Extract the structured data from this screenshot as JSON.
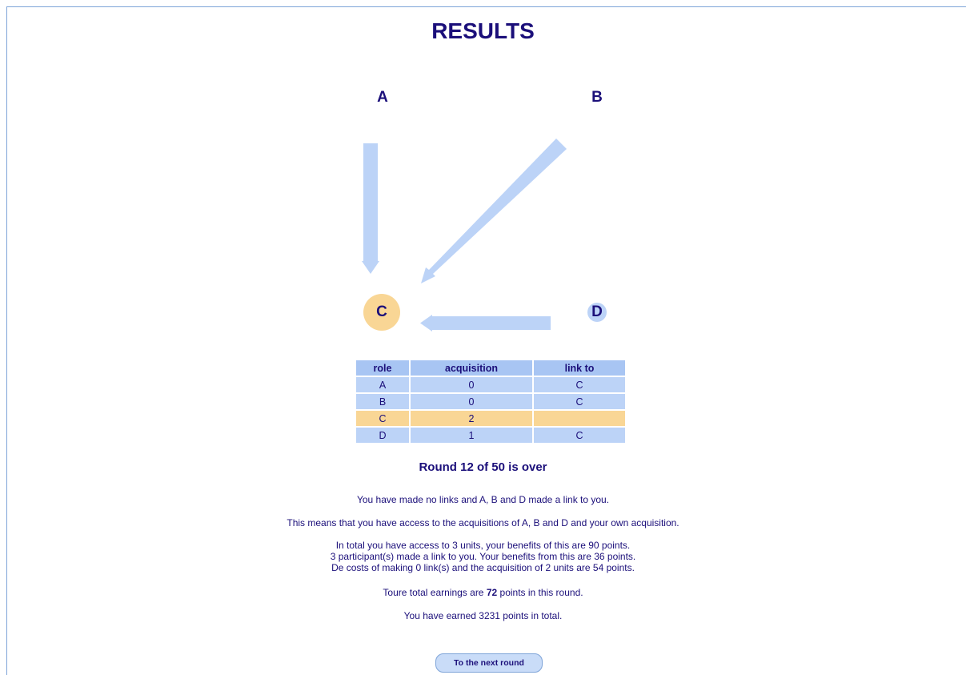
{
  "title": "RESULTS",
  "nodes": {
    "a": "A",
    "b": "B",
    "c": "C",
    "d": "D"
  },
  "colors": {
    "text": "#1b0f7a",
    "arrow": "#bcd3f7",
    "self_node": "#f9d695",
    "header": "#a8c5f3",
    "row": "#bcd3f7"
  },
  "table": {
    "headers": [
      "role",
      "acquisition",
      "link to"
    ],
    "rows": [
      {
        "role": "A",
        "acquisition": "0",
        "link_to": "C"
      },
      {
        "role": "B",
        "acquisition": "0",
        "link_to": "C"
      },
      {
        "role": "C",
        "acquisition": "2",
        "link_to": ""
      },
      {
        "role": "D",
        "acquisition": "1",
        "link_to": "C"
      }
    ]
  },
  "round_text": "Round 12 of 50 is over",
  "text": {
    "line1": "You have made no links and A, B and D made a link to you.",
    "line2": "This means that you have access to the acquisitions of A, B and D and your own acquisition.",
    "line3a": "In total you have access to 3 units, your benefits of this are 90 points.",
    "line3b": "3 participant(s) made a link to you. Your benefits from this are 36 points.",
    "line3c": "De costs of making 0 link(s) and the acquisition of 2 units are 54 points.",
    "earnings_prefix": "Toure total earnings are ",
    "earnings_value": "72",
    "earnings_suffix": " points in this round.",
    "total": "You have earned 3231 points in total."
  },
  "button_label": "To the next round"
}
